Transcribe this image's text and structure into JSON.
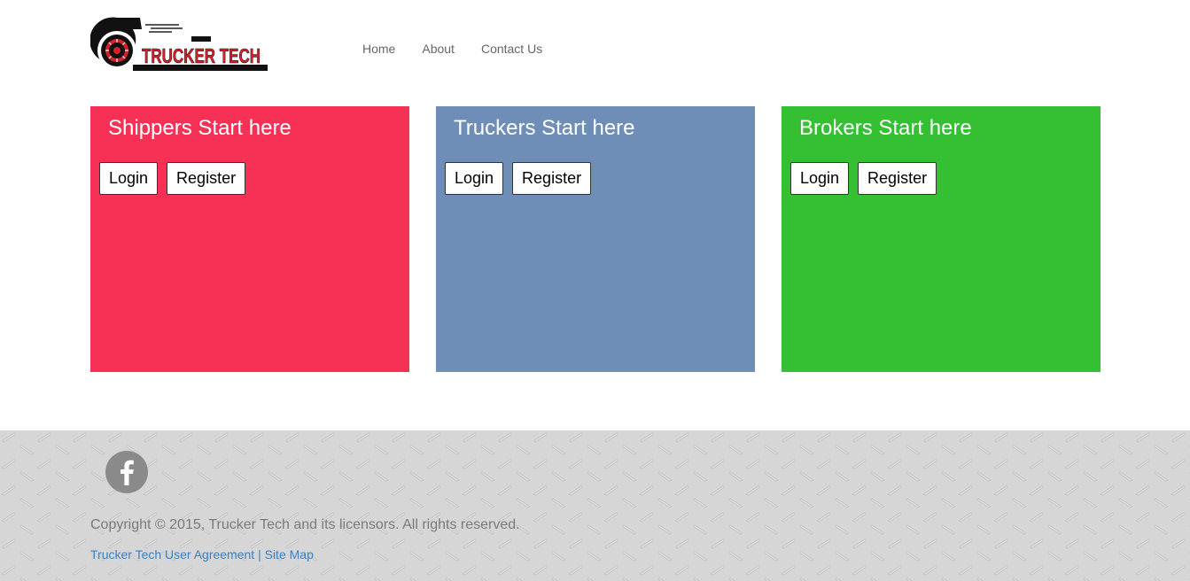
{
  "logo": {
    "text": "TRUCKER TECH"
  },
  "nav": {
    "items": [
      "Home",
      "About",
      "Contact Us"
    ]
  },
  "panels": [
    {
      "title": "Shippers Start here",
      "login": "Login",
      "register": "Register",
      "color": "#f73155"
    },
    {
      "title": "Truckers Start here",
      "login": "Login",
      "register": "Register",
      "color": "#6e8eb7"
    },
    {
      "title": "Brokers Start here",
      "login": "Login",
      "register": "Register",
      "color": "#35c034"
    }
  ],
  "footer": {
    "copyright": "Copyright © 2015, Trucker Tech and its licensors. All rights reserved.",
    "agreement_link": "Trucker Tech User Agreement",
    "separator": "|",
    "sitemap_link": "Site Map"
  },
  "colors": {
    "footer_bg": "#d6d6d6",
    "link": "#3b82c4",
    "nav_text": "#666666"
  }
}
